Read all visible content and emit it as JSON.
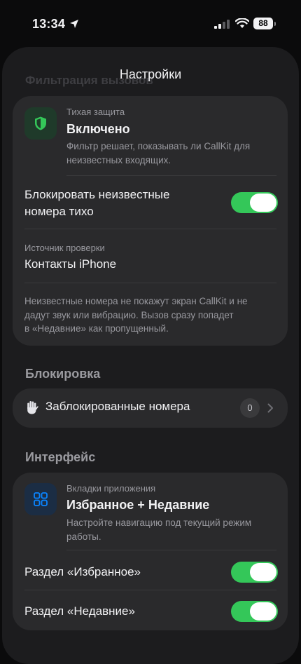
{
  "status_bar": {
    "time": "13:34",
    "battery": "88"
  },
  "nav": {
    "title": "Настройки",
    "ghost_header": "Фильтрация вызовов"
  },
  "quiet_protection": {
    "caption": "Тихая защита",
    "state": "Включено",
    "description": "Фильтр решает, показывать ли CallKit для неизвестных входящих.",
    "icon": "shield-icon",
    "accent_color": "#34c759"
  },
  "block_unknown": {
    "label_line1": "Блокировать неизвестные",
    "label_line2": "номера тихо",
    "enabled": true
  },
  "check_source": {
    "caption": "Источник проверки",
    "value": "Контакты iPhone"
  },
  "footnote": {
    "line1": "Неизвестные номера не покажут экран CallKit и не",
    "line2": "дадут звук или вибрацию. Вызов сразу попадет",
    "line3": "в «Недавние» как пропущенный."
  },
  "blocking_section": {
    "header": "Блокировка",
    "blocked_numbers": {
      "label": "Заблокированные номера",
      "count": "0",
      "icon": "hand-icon"
    }
  },
  "interface_section": {
    "header": "Интерфейс",
    "tabs_card": {
      "caption": "Вкладки приложения",
      "value": "Избранное + Недавние",
      "description": "Настройте навигацию под текущий режим работы.",
      "icon": "grid-icon",
      "accent_color": "#0a84ff"
    },
    "favorites_toggle": {
      "label": "Раздел «Избранное»",
      "enabled": true
    },
    "recents_toggle": {
      "label": "Раздел «Недавние»",
      "enabled": true
    }
  }
}
